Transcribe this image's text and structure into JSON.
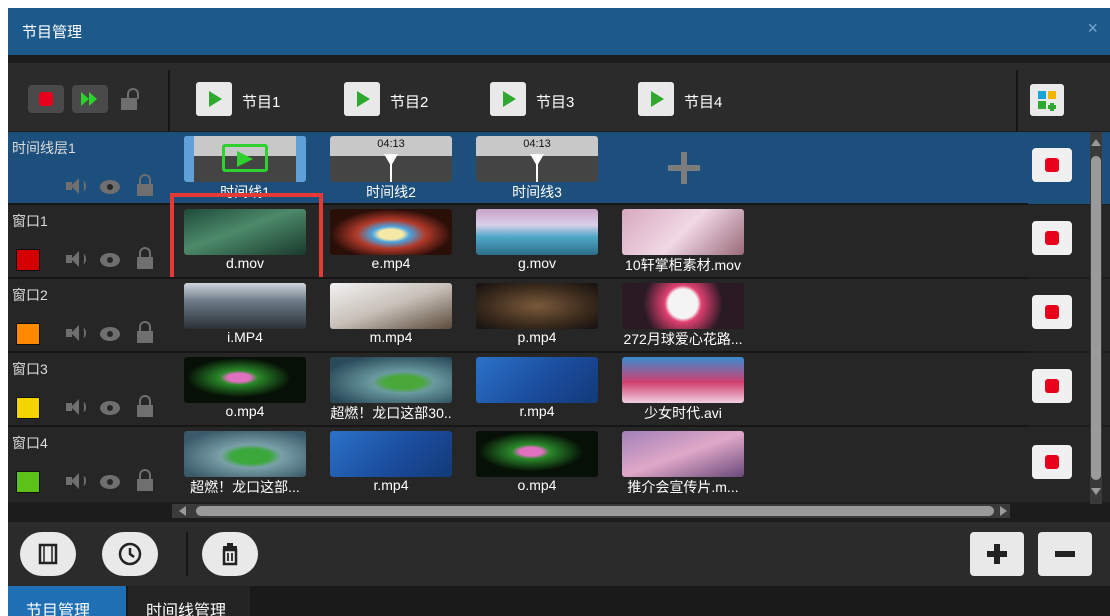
{
  "window": {
    "title": "节目管理",
    "close_label": "×"
  },
  "programs": [
    {
      "label": "节目1"
    },
    {
      "label": "节目2"
    },
    {
      "label": "节目3"
    },
    {
      "label": "节目4"
    }
  ],
  "rows": [
    {
      "name": "时间线层1",
      "type": "layer",
      "clips": [
        {
          "caption": "时间线1",
          "kind": "timeline-active"
        },
        {
          "caption": "时间线2",
          "kind": "timeline",
          "time": "04:13"
        },
        {
          "caption": "时间线3",
          "kind": "timeline",
          "time": "04:13"
        }
      ]
    },
    {
      "name": "窗口1",
      "color": "#d40000",
      "clips": [
        {
          "caption": "d.mov",
          "highlighted": true
        },
        {
          "caption": "e.mp4"
        },
        {
          "caption": "g.mov"
        },
        {
          "caption": "10轩掌柜素材.mov"
        }
      ]
    },
    {
      "name": "窗口2",
      "color": "#ff8a00",
      "clips": [
        {
          "caption": "i.MP4"
        },
        {
          "caption": "m.mp4"
        },
        {
          "caption": "p.mp4"
        },
        {
          "caption": "272月球爱心花路..."
        }
      ]
    },
    {
      "name": "窗口3",
      "color": "#f2d400",
      "clips": [
        {
          "caption": "o.mp4"
        },
        {
          "caption": "超燃！龙口这部30.."
        },
        {
          "caption": "r.mp4"
        },
        {
          "caption": "少女时代.avi"
        }
      ]
    },
    {
      "name": "窗口4",
      "color": "#5cc21a",
      "clips": [
        {
          "caption": "超燃！龙口这部..."
        },
        {
          "caption": "r.mp4"
        },
        {
          "caption": "o.mp4"
        },
        {
          "caption": "推介会宣传片.m..."
        }
      ]
    }
  ],
  "tabs": [
    {
      "label": "节目管理",
      "active": true
    },
    {
      "label": "时间线管理",
      "active": false
    }
  ],
  "icons": {
    "record": "record-icon",
    "forward": "fast-forward-icon",
    "lock": "lock-icon",
    "layout": "layout-grid-icon",
    "speaker": "speaker-icon",
    "eye": "eye-icon",
    "screen": "screen-icon",
    "clock": "clock-icon",
    "trash": "trash-icon",
    "plus": "plus-icon",
    "minus": "minus-icon"
  },
  "colors": {
    "accent": "#1e6fb3",
    "titlebar": "#1c5a8c",
    "record": "#e8001c",
    "play": "#2ea82e",
    "highlight": "#e53935"
  }
}
